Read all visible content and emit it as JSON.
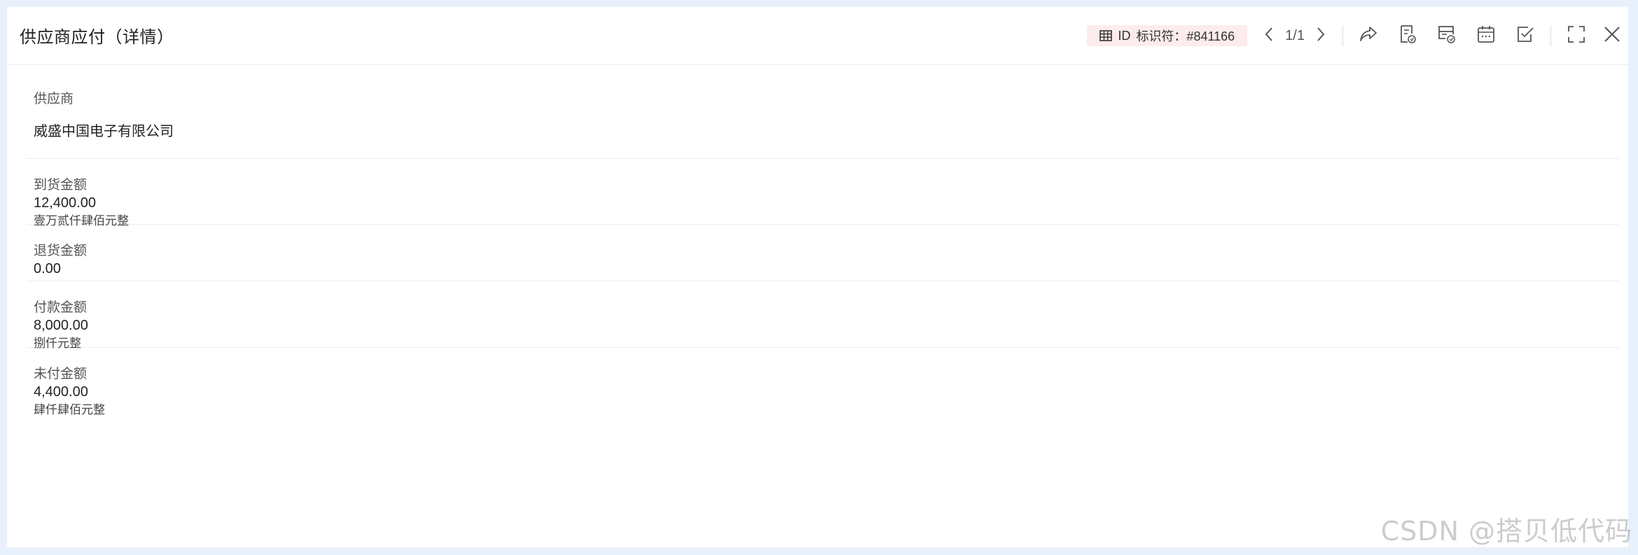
{
  "window": {
    "title": "供应商应付（详情）",
    "id_label": "ID",
    "id_text": "标识符：#841166",
    "pagination": "1/1"
  },
  "fields": [
    {
      "label": "供应商",
      "value": "威盛中国电子有限公司",
      "link": true
    },
    {
      "label": "到货金额",
      "value": "12,400.00",
      "sub": "壹万贰仟肆佰元整"
    },
    {
      "label": "退货金额",
      "value": "0.00"
    },
    {
      "label": "付款金额",
      "value": "8,000.00",
      "sub": "捌仟元整"
    },
    {
      "label": "未付金额",
      "value": "4,400.00",
      "sub": "肆仟肆佰元整"
    }
  ],
  "watermark": "CSDN @搭贝低代码",
  "icons": [
    "table-grid-icon",
    "chevron-left-icon",
    "chevron-right-icon",
    "share-icon",
    "document-icon",
    "print-icon",
    "calendar-icon",
    "checkbox-icon",
    "fullscreen-icon",
    "close-icon"
  ],
  "colors": {
    "link": "#2f86e6",
    "id_tag_bg": "#fdecec",
    "page_bg": "#e8f0fb"
  }
}
